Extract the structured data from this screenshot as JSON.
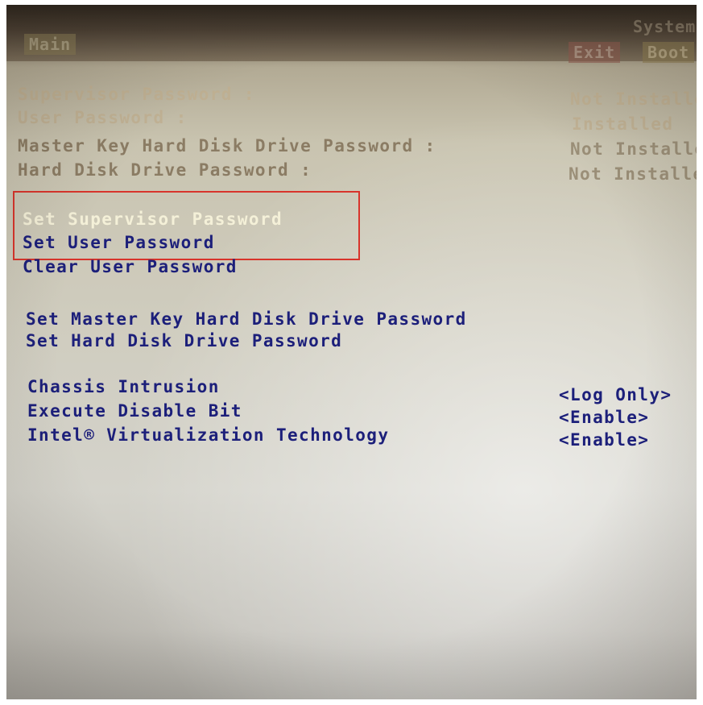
{
  "tabs": {
    "main": "Main",
    "system": "System",
    "exit": "Exit",
    "boot": "Boot"
  },
  "status": [
    {
      "label": "Supervisor Password :",
      "value": "Not Installed"
    },
    {
      "label": "User Password :",
      "value": "Installed"
    },
    {
      "label": "Master Key Hard Disk Drive Password :",
      "value": "Not Installed"
    },
    {
      "label": "Hard Disk Drive Password :",
      "value": "Not Installed"
    }
  ],
  "password_actions": [
    "Set Supervisor Password",
    "Set User Password",
    "Clear User Password"
  ],
  "disk_actions": [
    "Set Master Key Hard Disk Drive Password",
    "Set Hard Disk Drive Password"
  ],
  "settings": [
    {
      "label": "Chassis Intrusion",
      "value": "<Log Only>"
    },
    {
      "label": "Execute Disable Bit",
      "value": "<Enable>"
    },
    {
      "label": "Intel® Virtualization Technology",
      "value": "<Enable>"
    }
  ],
  "colors": {
    "label": "#1c1f7a",
    "selected": "#f4f0d8",
    "highlight_box": "#d8342b"
  }
}
